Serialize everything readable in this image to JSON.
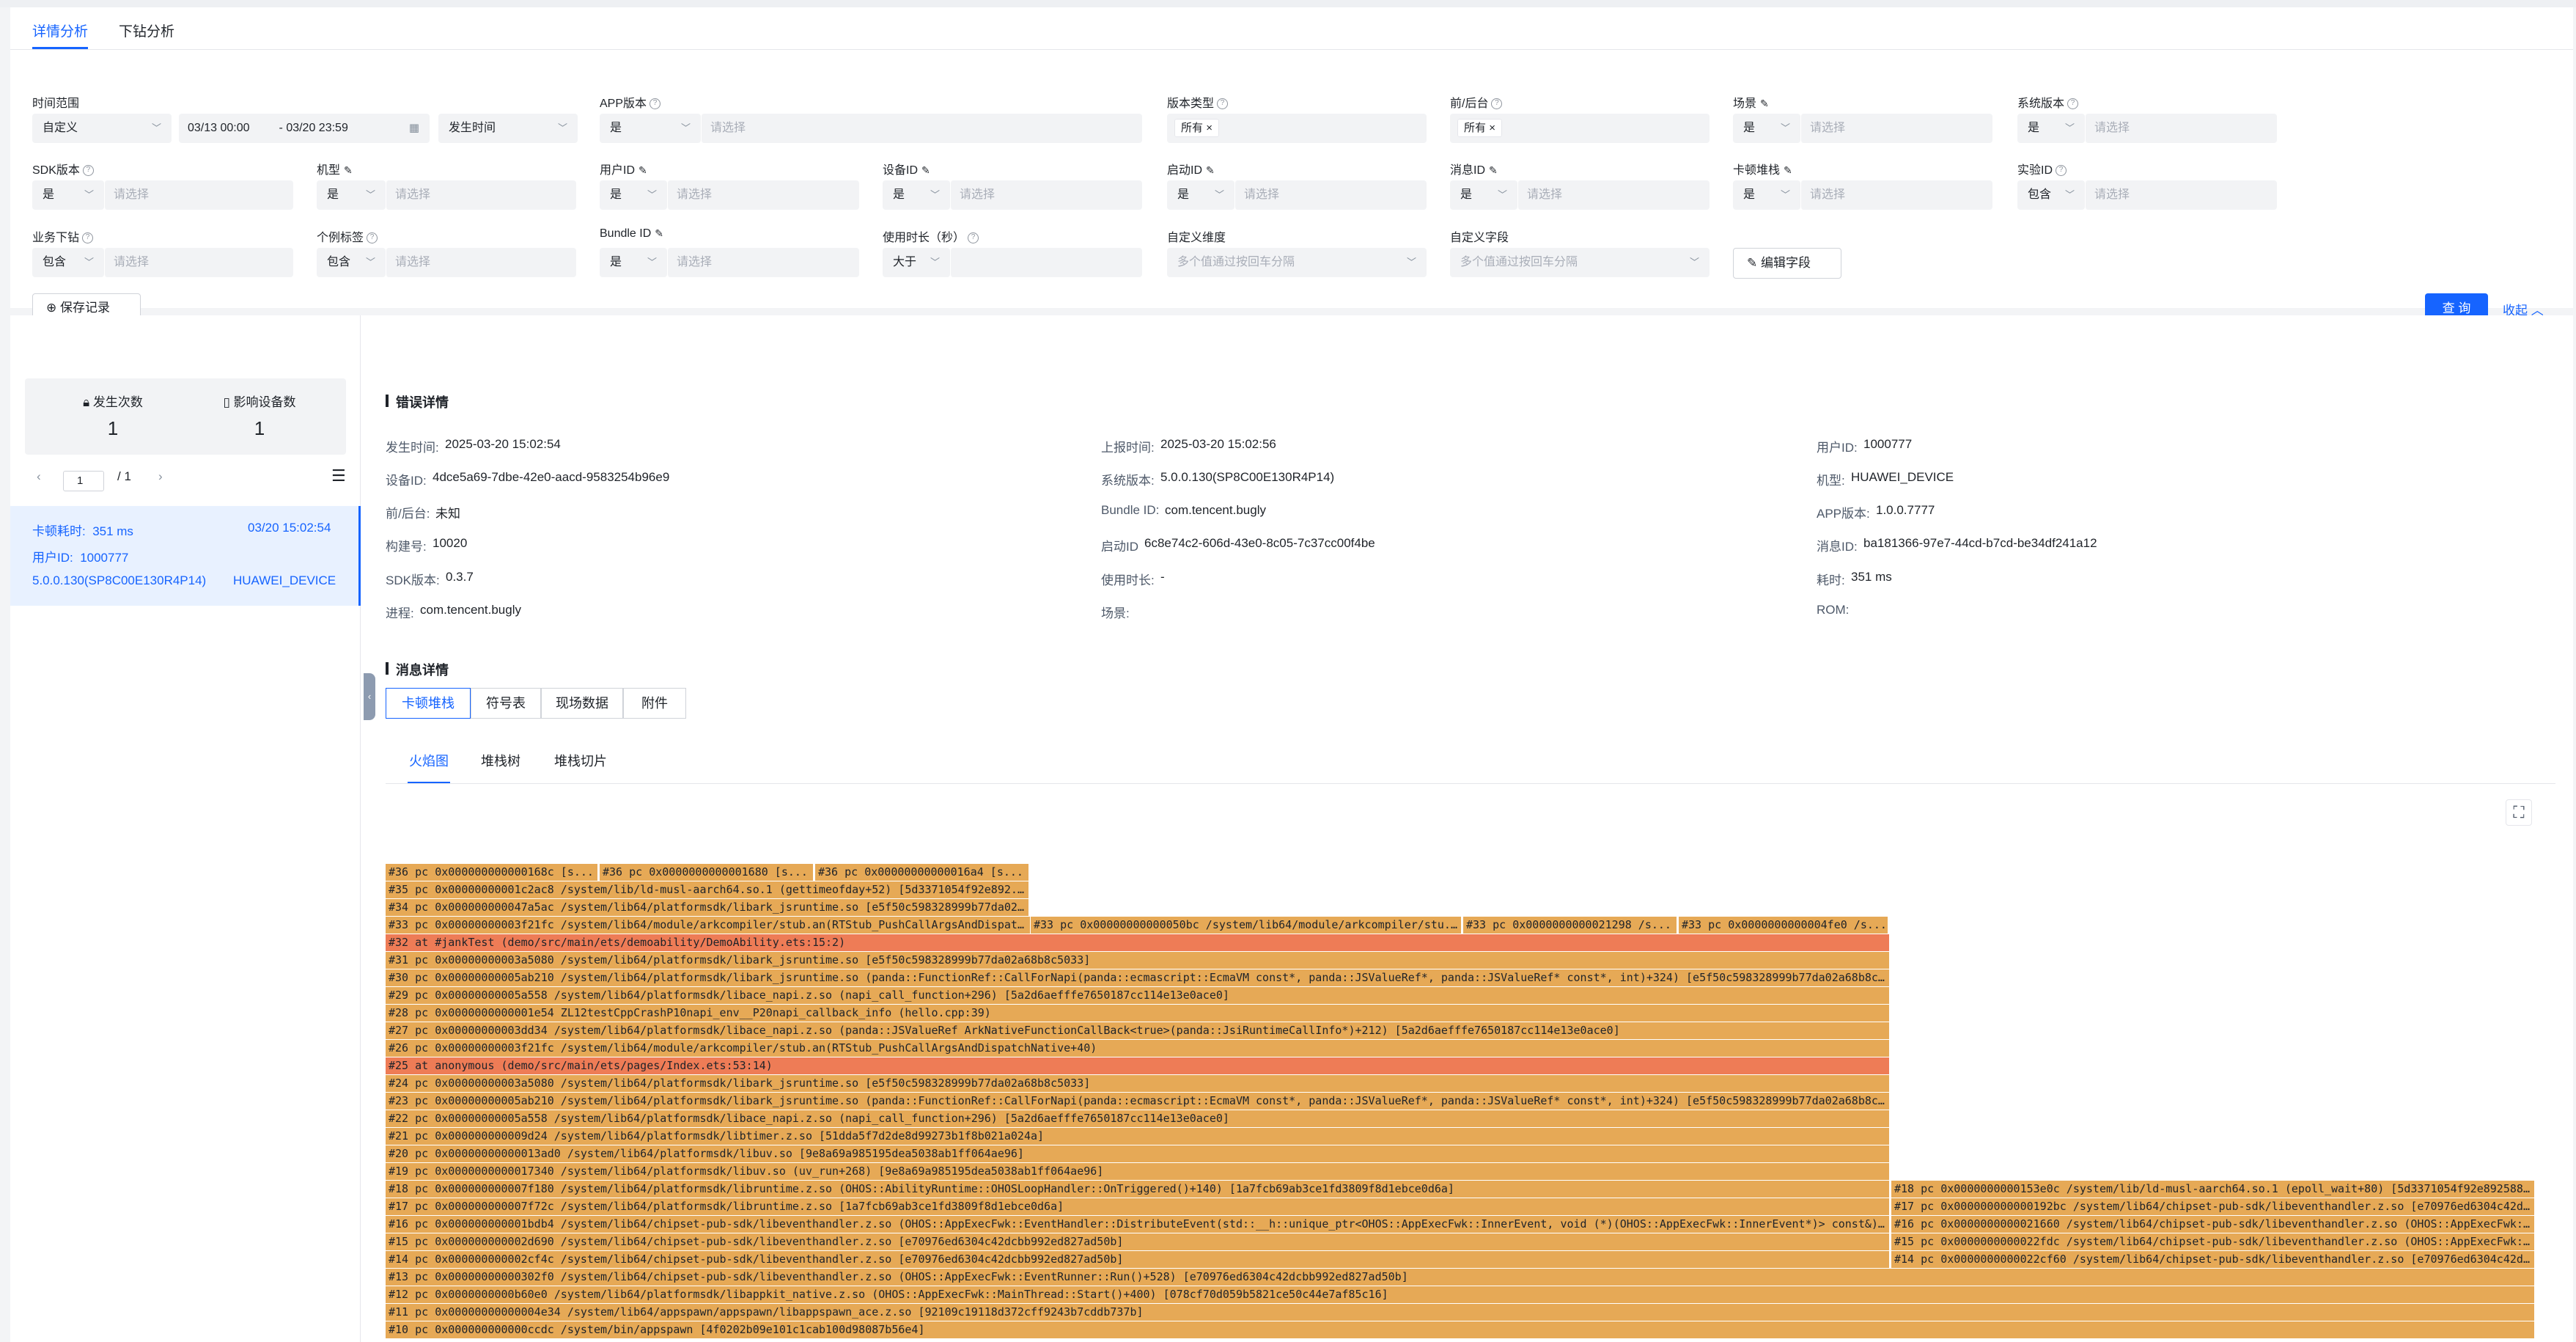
{
  "top_tabs": [
    {
      "label": "详情分析"
    },
    {
      "label": "下钻分析"
    }
  ],
  "filters": {
    "time_range": {
      "label": "时间范围",
      "mode": "自定义",
      "start": "03/13 00:00",
      "sep": "-",
      "end": "03/20 23:59",
      "type": "发生时间"
    },
    "app_version": {
      "label": "APP版本",
      "op": "是",
      "placeholder": "请选择"
    },
    "build_type": {
      "label": "版本类型",
      "tag": "所有"
    },
    "foreground": {
      "label": "前/后台",
      "tag": "所有"
    },
    "scene": {
      "label": "场景",
      "op": "是",
      "placeholder": "请选择"
    },
    "os_version": {
      "label": "系统版本",
      "op": "是",
      "placeholder": "请选择"
    },
    "sdk_version": {
      "label": "SDK版本",
      "op": "是",
      "placeholder": "请选择"
    },
    "model": {
      "label": "机型",
      "op": "是",
      "placeholder": "请选择"
    },
    "user_id": {
      "label": "用户ID",
      "op": "是",
      "placeholder": "请选择"
    },
    "device_id": {
      "label": "设备ID",
      "op": "是",
      "placeholder": "请选择"
    },
    "launch_id": {
      "label": "启动ID",
      "op": "是",
      "placeholder": "请选择"
    },
    "message_id": {
      "label": "消息ID",
      "op": "是",
      "placeholder": "请选择"
    },
    "stack": {
      "label": "卡顿堆栈",
      "op": "是",
      "placeholder": "请选择"
    },
    "experiment_id": {
      "label": "实验ID",
      "op": "包含",
      "placeholder": "请选择"
    },
    "business_drill": {
      "label": "业务下钻",
      "op": "包含",
      "placeholder": "请选择"
    },
    "case_tag": {
      "label": "个例标签",
      "op": "包含",
      "placeholder": "请选择"
    },
    "bundle_id": {
      "label": "Bundle ID",
      "op": "是",
      "placeholder": "请选择"
    },
    "duration": {
      "label": "使用时长（秒）",
      "op": "大于"
    },
    "custom_dim": {
      "label": "自定义维度",
      "placeholder": "多个值通过按回车分隔"
    },
    "custom_field": {
      "label": "自定义字段",
      "placeholder": "多个值通过按回车分隔"
    },
    "edit_fields": "编辑字段",
    "save_record": "保存记录",
    "query": "查 询",
    "collapse": "收起"
  },
  "sidebar": {
    "occurrences_label": "发生次数",
    "occurrences": "1",
    "devices_label": "影响设备数",
    "devices": "1",
    "page": "1",
    "page_total": "/ 1",
    "item": {
      "lag_label": "卡顿耗时:",
      "lag_value": "351 ms",
      "time": "03/20 15:02:54",
      "user_label": "用户ID:",
      "user_value": "1000777",
      "os": "5.0.0.130(SP8C00E130R4P14)",
      "device": "HUAWEI_DEVICE"
    }
  },
  "error_details": {
    "title": "错误详情",
    "fields": [
      {
        "label": "发生时间:",
        "value": "2025-03-20 15:02:54"
      },
      {
        "label": "上报时间:",
        "value": "2025-03-20 15:02:56"
      },
      {
        "label": "用户ID:",
        "value": "1000777"
      },
      {
        "label": "设备ID:",
        "value": "4dce5a69-7dbe-42e0-aacd-9583254b96e9"
      },
      {
        "label": "系统版本:",
        "value": "5.0.0.130(SP8C00E130R4P14)"
      },
      {
        "label": "机型:",
        "value": "HUAWEI_DEVICE"
      },
      {
        "label": "前/后台:",
        "value": "未知"
      },
      {
        "label": "Bundle ID:",
        "value": "com.tencent.bugly"
      },
      {
        "label": "APP版本:",
        "value": "1.0.0.7777"
      },
      {
        "label": "构建号:",
        "value": "10020"
      },
      {
        "label": "启动ID",
        "value": "6c8e74c2-606d-43e0-8c05-7c37cc00f4be"
      },
      {
        "label": "消息ID:",
        "value": "ba181366-97e7-44cd-b7cd-be34df241a12"
      },
      {
        "label": "SDK版本:",
        "value": "0.3.7"
      },
      {
        "label": "使用时长:",
        "value": "-"
      },
      {
        "label": "耗时:",
        "value": "351 ms"
      },
      {
        "label": "进程:",
        "value": "com.tencent.bugly"
      },
      {
        "label": "场景:",
        "value": ""
      },
      {
        "label": "ROM:",
        "value": ""
      }
    ]
  },
  "message_details": {
    "title": "消息详情",
    "tabs": [
      {
        "label": "卡顿堆栈"
      },
      {
        "label": "符号表"
      },
      {
        "label": "现场数据"
      },
      {
        "label": "附件"
      }
    ],
    "view_tabs": [
      {
        "label": "火焰图"
      },
      {
        "label": "堆栈树"
      },
      {
        "label": "堆栈切片"
      }
    ]
  },
  "colors": {
    "accent": "#1664ff",
    "frame_normal": "#e6a956",
    "frame_hot": "#ee7c56"
  },
  "flame": [
    {
      "text": "#36 pc 0x000000000000168c [s...",
      "hot": false
    },
    {
      "text": "#36 pc 0x0000000000001680 [s...",
      "hot": false
    },
    {
      "text": "#36 pc 0x00000000000016a4 [s...",
      "hot": false
    },
    {
      "text": "#35 pc 0x00000000001c2ac8 /system/lib/ld-musl-aarch64.so.1 (gettimeofday+52) [5d3371054f92e892...",
      "hot": false
    },
    {
      "text": "#34 pc 0x000000000047a5ac /system/lib64/platformsdk/libark_jsruntime.so [e5f50c598328999b77da02...",
      "hot": false
    },
    {
      "text": "#33 pc 0x00000000003f21fc /system/lib64/module/arkcompiler/stub.an(RTStub_PushCallArgsAndDispat...",
      "hot": false
    },
    {
      "text": "#33 pc 0x00000000000050bc /system/lib64/module/arkcompiler/stu...",
      "hot": false
    },
    {
      "text": "#33 pc 0x0000000000021298 /s...",
      "hot": false
    },
    {
      "text": "#33 pc 0x0000000000004fe0 /s...",
      "hot": false
    },
    {
      "text": "#32 at #jankTest (demo/src/main/ets/demoability/DemoAbility.ets:15:2)",
      "hot": true
    },
    {
      "text": "#31 pc 0x00000000003a5080 /system/lib64/platformsdk/libark_jsruntime.so [e5f50c598328999b77da02a68b8c5033]",
      "hot": false
    },
    {
      "text": "#30 pc 0x00000000005ab210 /system/lib64/platformsdk/libark_jsruntime.so (panda::FunctionRef::CallForNapi(panda::ecmascript::EcmaVM const*, panda::JSValueRef*, panda::JSValueRef* const*, int)+324) [e5f50c598328999b77da02a68b8c5033]",
      "hot": false
    },
    {
      "text": "#29 pc 0x00000000005a558 /system/lib64/platformsdk/libace_napi.z.so (napi_call_function+296) [5a2d6aefffe7650187cc114e13e0ace0]",
      "hot": false
    },
    {
      "text": "#28 pc 0x0000000000001e54 ZL12testCppCrashP10napi_env__P20napi_callback_info (hello.cpp:39)",
      "hot": false
    },
    {
      "text": "#27 pc 0x00000000003dd34 /system/lib64/platformsdk/libace_napi.z.so (panda::JSValueRef ArkNativeFunctionCallBack<true>(panda::JsiRuntimeCallInfo*)+212) [5a2d6aefffe7650187cc114e13e0ace0]",
      "hot": false
    },
    {
      "text": "#26 pc 0x00000000003f21fc /system/lib64/module/arkcompiler/stub.an(RTStub_PushCallArgsAndDispatchNative+40)",
      "hot": false
    },
    {
      "text": "#25 at anonymous (demo/src/main/ets/pages/Index.ets:53:14)",
      "hot": true
    },
    {
      "text": "#24 pc 0x00000000003a5080 /system/lib64/platformsdk/libark_jsruntime.so [e5f50c598328999b77da02a68b8c5033]",
      "hot": false
    },
    {
      "text": "#23 pc 0x00000000005ab210 /system/lib64/platformsdk/libark_jsruntime.so (panda::FunctionRef::CallForNapi(panda::ecmascript::EcmaVM const*, panda::JSValueRef*, panda::JSValueRef* const*, int)+324) [e5f50c598328999b77da02a68b8c5033]",
      "hot": false
    },
    {
      "text": "#22 pc 0x00000000005a558 /system/lib64/platformsdk/libace_napi.z.so (napi_call_function+296) [5a2d6aefffe7650187cc114e13e0ace0]",
      "hot": false
    },
    {
      "text": "#21 pc 0x000000000009d24 /system/lib64/platformsdk/libtimer.z.so [51dda5f7d2de8d99273b1f8b021a024a]",
      "hot": false
    },
    {
      "text": "#20 pc 0x00000000000013ad0 /system/lib64/platformsdk/libuv.so [9e8a69a985195dea5038ab1ff064ae96]",
      "hot": false
    },
    {
      "text": "#19 pc 0x0000000000017340 /system/lib64/platformsdk/libuv.so (uv_run+268) [9e8a69a985195dea5038ab1ff064ae96]",
      "hot": false
    },
    {
      "text": "#18 pc 0x000000000007f180 /system/lib64/platformsdk/libruntime.z.so (OHOS::AbilityRuntime::OHOSLoopHandler::OnTriggered()+140) [1a7fcb69ab3ce1fd3809f8d1ebce0d6a]",
      "hot": false
    },
    {
      "text": "#18 pc 0x0000000000153e0c /system/lib/ld-musl-aarch64.so.1 (epoll_wait+80) [5d3371054f92e892588...",
      "hot": false
    },
    {
      "text": "#17 pc 0x000000000007f72c /system/lib64/platformsdk/libruntime.z.so [1a7fcb69ab3ce1fd3809f8d1ebce0d6a]",
      "hot": false
    },
    {
      "text": "#17 pc 0x000000000000192bc /system/lib64/chipset-pub-sdk/libeventhandler.z.so [e70976ed6304c42dcb...",
      "hot": false
    },
    {
      "text": "#16 pc 0x000000000001bdb4 /system/lib64/chipset-pub-sdk/libeventhandler.z.so (OHOS::AppExecFwk::EventHandler::DistributeEvent(std::__h::unique_ptr<OHOS::AppExecFwk::InnerEvent, void (*)(OHOS::AppExecFwk::InnerEvent*)> const&)+...",
      "hot": false
    },
    {
      "text": "#16 pc 0x0000000000021660 /system/lib64/chipset-pub-sdk/libeventhandler.z.so (OHOS::AppExecFwk::...",
      "hot": false
    },
    {
      "text": "#15 pc 0x000000000002d690 /system/lib64/chipset-pub-sdk/libeventhandler.z.so [e70976ed6304c42dcbb992ed827ad50b]",
      "hot": false
    },
    {
      "text": "#15 pc 0x0000000000022fdc /system/lib64/chipset-pub-sdk/libeventhandler.z.so (OHOS::AppExecFwk::...",
      "hot": false
    },
    {
      "text": "#14 pc 0x000000000002cf4c /system/lib64/chipset-pub-sdk/libeventhandler.z.so [e70976ed6304c42dcbb992ed827ad50b]",
      "hot": false
    },
    {
      "text": "#14 pc 0x0000000000022cf60 /system/lib64/chipset-pub-sdk/libeventhandler.z.so [e70976ed6304c42dcb...",
      "hot": false
    },
    {
      "text": "#13 pc 0x00000000000302f0 /system/lib64/chipset-pub-sdk/libeventhandler.z.so (OHOS::AppExecFwk::EventRunner::Run()+528) [e70976ed6304c42dcbb992ed827ad50b]",
      "hot": false
    },
    {
      "text": "#12 pc 0x0000000000b60e0 /system/lib64/platformsdk/libappkit_native.z.so (OHOS::AppExecFwk::MainThread::Start()+400) [078cf70d059b5821ce50c44e7af85c16]",
      "hot": false
    },
    {
      "text": "#11 pc 0x00000000000004e34 /system/lib64/appspawn/appspawn/libappspawn_ace.z.so [92109c19118d372cff9243b7cddb737b]",
      "hot": false
    },
    {
      "text": "#10 pc 0x000000000000ccdc /system/bin/appspawn [4f0202b09e101c1cab100d98087b56e4]",
      "hot": false
    }
  ]
}
